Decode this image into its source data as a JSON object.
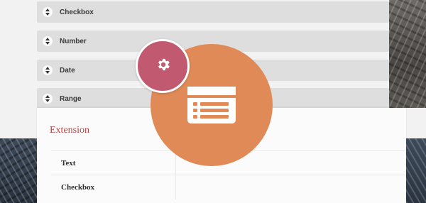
{
  "fields": [
    {
      "label": "Checkbox"
    },
    {
      "label": "Number"
    },
    {
      "label": "Date"
    },
    {
      "label": "Range"
    }
  ],
  "panel": {
    "title": "Extension",
    "rows": [
      {
        "label": "Text",
        "value": ""
      },
      {
        "label": "Checkbox",
        "value": ""
      }
    ]
  },
  "icons": {
    "gear": "gear-icon",
    "form": "form-list-icon",
    "sort": "sort-handle-icon"
  },
  "colors": {
    "accent_orange": "#e08a58",
    "accent_pink": "#c15a70",
    "title_red": "#b24646"
  }
}
